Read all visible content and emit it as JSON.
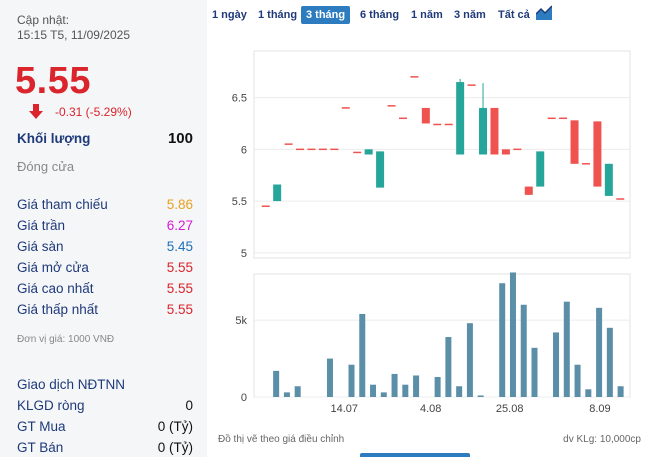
{
  "header": {
    "update_label": "Cập nhật:",
    "update_time": "15:15 T5, 11/09/2025",
    "price": "5.55",
    "change": "-0.31 (-5.29%)"
  },
  "stats": {
    "volume_label": "Khối lượng",
    "volume_value": "100",
    "status": "Đóng cửa",
    "ref_label": "Giá tham chiếu",
    "ref_value": "5.86",
    "ceil_label": "Giá trần",
    "ceil_value": "6.27",
    "floor_label": "Giá sàn",
    "floor_value": "5.45",
    "open_label": "Giá mở cửa",
    "open_value": "5.55",
    "high_label": "Giá cao nhất",
    "high_value": "5.55",
    "low_label": "Giá thấp nhất",
    "low_value": "5.55",
    "unit_note": "Đơn vị giá: 1000 VNĐ"
  },
  "foreign": {
    "title": "Giao dịch NĐTNN",
    "net_label": "KLGD ròng",
    "net_value": "0",
    "buy_label": "GT Mua",
    "buy_value": "0 (Tỷ)",
    "sell_label": "GT Bán",
    "sell_value": "0 (Tỷ)"
  },
  "tabs": [
    "1 ngày",
    "1 tháng",
    "3 tháng",
    "6 tháng",
    "1 năm",
    "3 năm",
    "Tất cả"
  ],
  "active_tab": "3 tháng",
  "footer": {
    "note": "Đồ thị vẽ theo giá điều chỉnh",
    "unit": "dv KLg: 10,000cp"
  },
  "colors": {
    "up": "#26a69a",
    "down": "#ef5350",
    "ref_color": "#e8a020",
    "ceil_color": "#d61ad6",
    "floor_color": "#1e6fb8",
    "price_red": "#d9252b",
    "volume": "#5b8fa8"
  },
  "chart_data": [
    {
      "type": "candlestick",
      "y_ticks": [
        "5",
        "5.5",
        "6",
        "6.5"
      ],
      "ylim": [
        4.95,
        6.95
      ],
      "x_ticks": [
        "14.07",
        "4.08",
        "25.08",
        "8.09"
      ],
      "candles": [
        {
          "o": 5.45,
          "c": 5.45,
          "h": 5.45,
          "l": 5.45
        },
        {
          "o": 5.5,
          "c": 5.66,
          "h": 5.66,
          "l": 5.5
        },
        {
          "o": 6.05,
          "c": 6.05,
          "h": 6.05,
          "l": 6.05
        },
        {
          "o": 6.0,
          "c": 6.0,
          "h": 6.0,
          "l": 6.0
        },
        {
          "o": 6.0,
          "c": 6.0,
          "h": 6.0,
          "l": 6.0
        },
        {
          "o": 6.0,
          "c": 6.0,
          "h": 6.0,
          "l": 6.0
        },
        {
          "o": 6.0,
          "c": 6.0,
          "h": 6.0,
          "l": 6.0
        },
        {
          "o": 6.4,
          "c": 6.4,
          "h": 6.4,
          "l": 6.4
        },
        {
          "o": 5.97,
          "c": 5.97,
          "h": 5.97,
          "l": 5.97
        },
        {
          "o": 5.95,
          "c": 6.0,
          "h": 6.0,
          "l": 5.95
        },
        {
          "o": 5.63,
          "c": 5.98,
          "h": 5.98,
          "l": 5.63
        },
        {
          "o": 6.42,
          "c": 6.42,
          "h": 6.42,
          "l": 6.42
        },
        {
          "o": 6.3,
          "c": 6.3,
          "h": 6.3,
          "l": 6.3
        },
        {
          "o": 6.7,
          "c": 6.7,
          "h": 6.7,
          "l": 6.7
        },
        {
          "o": 6.4,
          "c": 6.25,
          "h": 6.4,
          "l": 6.25
        },
        {
          "o": 6.24,
          "c": 6.24,
          "h": 6.24,
          "l": 6.24
        },
        {
          "o": 6.24,
          "c": 6.24,
          "h": 6.24,
          "l": 6.24
        },
        {
          "o": 5.95,
          "c": 6.65,
          "h": 6.68,
          "l": 5.95
        },
        {
          "o": 6.62,
          "c": 6.62,
          "h": 6.62,
          "l": 6.62
        },
        {
          "o": 5.95,
          "c": 6.4,
          "h": 6.64,
          "l": 5.95
        },
        {
          "o": 6.4,
          "c": 5.95,
          "h": 6.4,
          "l": 5.95
        },
        {
          "o": 6.0,
          "c": 5.95,
          "h": 6.0,
          "l": 5.95
        },
        {
          "o": 6.0,
          "c": 6.0,
          "h": 6.0,
          "l": 6.0
        },
        {
          "o": 5.64,
          "c": 5.56,
          "h": 5.64,
          "l": 5.56
        },
        {
          "o": 5.64,
          "c": 5.98,
          "h": 5.98,
          "l": 5.64
        },
        {
          "o": 6.3,
          "c": 6.3,
          "h": 6.3,
          "l": 6.3
        },
        {
          "o": 6.3,
          "c": 6.3,
          "h": 6.3,
          "l": 6.3
        },
        {
          "o": 6.28,
          "c": 5.86,
          "h": 6.28,
          "l": 5.86
        },
        {
          "o": 5.86,
          "c": 5.86,
          "h": 5.86,
          "l": 5.86
        },
        {
          "o": 6.27,
          "c": 5.64,
          "h": 6.27,
          "l": 5.64
        },
        {
          "o": 5.55,
          "c": 5.86,
          "h": 5.86,
          "l": 5.55
        },
        {
          "o": 5.52,
          "c": 5.52,
          "h": 5.52,
          "l": 5.52
        }
      ]
    },
    {
      "type": "bar",
      "name": "Khối lượng",
      "y_ticks": [
        "0",
        "5k"
      ],
      "ylim": [
        0,
        8000
      ],
      "values": [
        0,
        1700,
        300,
        700,
        0,
        0,
        2500,
        0,
        2100,
        5400,
        800,
        300,
        1500,
        800,
        1400,
        0,
        1300,
        3900,
        700,
        4800,
        100,
        0,
        7400,
        8100,
        6000,
        3200,
        0,
        4200,
        6200,
        2100,
        500,
        5800,
        4500,
        700
      ]
    }
  ]
}
